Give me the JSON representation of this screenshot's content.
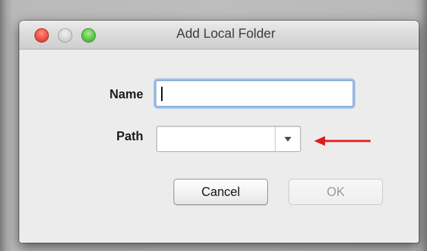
{
  "window": {
    "title": "Add Local Folder"
  },
  "form": {
    "name_label": "Name",
    "name_value": "",
    "path_label": "Path",
    "path_value": ""
  },
  "buttons": {
    "cancel_label": "Cancel",
    "ok_label": "OK"
  },
  "icons": {
    "close": "close-traffic-light",
    "minimize": "minimize-traffic-light",
    "zoom": "zoom-traffic-light",
    "dropdown": "chevron-down-icon",
    "annotation": "red-arrow-icon"
  },
  "colors": {
    "close": "#ef4e43",
    "zoom": "#5fc84a",
    "focus_ring": "#5b9ce6",
    "annotation_arrow": "#e01b1b"
  }
}
